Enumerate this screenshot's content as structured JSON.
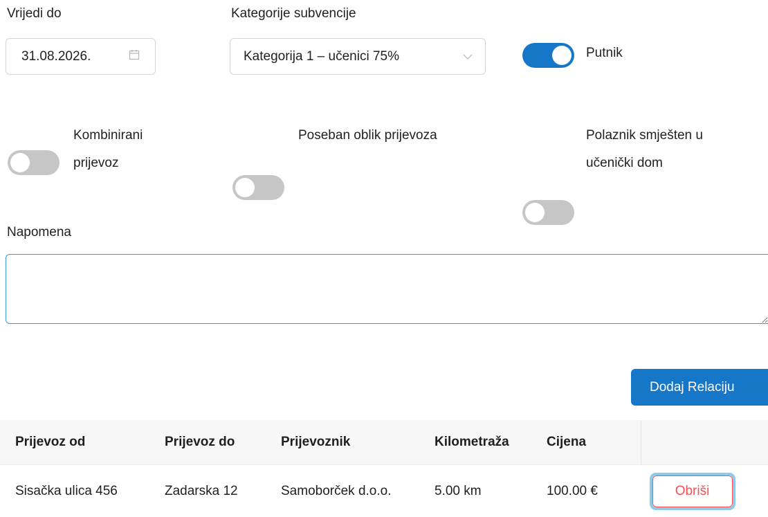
{
  "valid_until": {
    "label": "Vrijedi do",
    "value": "31.08.2026."
  },
  "category": {
    "label": "Kategorije subvencije",
    "value": "Kategorija 1 – učenici 75%"
  },
  "toggles": {
    "passenger": {
      "label": "Putnik",
      "on": true
    },
    "combined": {
      "label_line1": "Kombinirani",
      "label_line2": "prijevoz",
      "on": false
    },
    "special": {
      "label": "Poseban oblik prijevoza",
      "on": false
    },
    "dorm": {
      "label_line1": "Polaznik smješten u",
      "label_line2": "učenički dom",
      "on": false
    }
  },
  "note": {
    "label": "Napomena",
    "value": ""
  },
  "add_button": "Dodaj Relaciju",
  "table": {
    "headers": [
      "Prijevoz od",
      "Prijevoz do",
      "Prijevoznik",
      "Kilometraža",
      "Cijena"
    ],
    "rows": [
      {
        "from": "Sisačka ulica 456",
        "to": "Zadarska 12",
        "carrier": "Samoborček d.o.o.",
        "km": "5.00 km",
        "price": "100.00 €",
        "delete": "Obriši"
      }
    ]
  },
  "colors": {
    "primary": "#1677c9",
    "danger": "#ff4d4f",
    "focus_ring": "#8ccbea"
  }
}
